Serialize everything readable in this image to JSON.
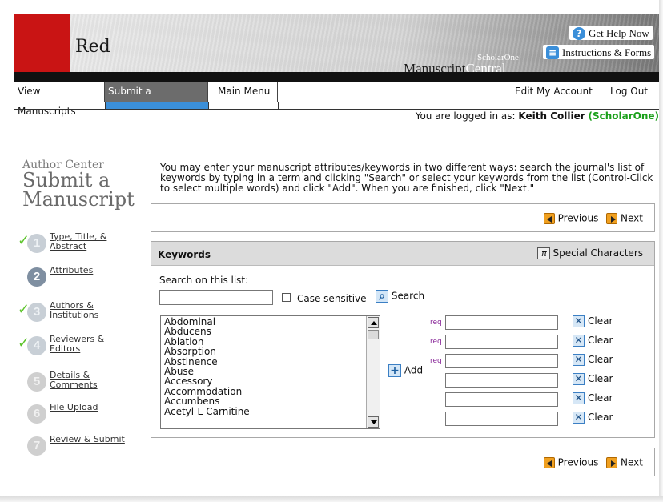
{
  "header": {
    "brand": "Red",
    "product_line1": "ScholarOne",
    "product_line2a": "Manuscript",
    "product_line2b": "Central",
    "help_link": "Get Help Now",
    "instructions_link": "Instructions & Forms",
    "colors": {
      "brand_red": "#c91414",
      "help_blue": "#3b8fd9"
    }
  },
  "nav": {
    "items": [
      {
        "label": "View Manuscripts"
      },
      {
        "label": "Submit a Manuscript",
        "active": true
      },
      {
        "label": "Main Menu"
      },
      {
        "label": "Edit My Account"
      },
      {
        "label": "Log Out"
      }
    ],
    "logged_in_prefix": "You are logged in as:",
    "user": "Keith Collier",
    "org": "(ScholarOne)"
  },
  "sidebar": {
    "section": "Author Center",
    "title_line1": "Submit a",
    "title_line2": "Manuscript",
    "steps": [
      {
        "num": "1",
        "label": "Type, Title, & Abstract",
        "done": true
      },
      {
        "num": "2",
        "label": "Attributes",
        "current": true
      },
      {
        "num": "3",
        "label": "Authors & Institutions",
        "done": true
      },
      {
        "num": "4",
        "label": "Reviewers & Editors",
        "done": true
      },
      {
        "num": "5",
        "label": "Details & Comments"
      },
      {
        "num": "6",
        "label": "File Upload"
      },
      {
        "num": "7",
        "label": "Review & Submit"
      }
    ]
  },
  "main": {
    "intro": "You may enter your manuscript attributes/keywords in two different ways: search the journal's list of keywords by typing in a term and clicking \"Search\" or select your keywords from the list (Control-Click to select multiple words) and click \"Add\". When you are finished, click \"Next.\"",
    "previous_label": "Previous",
    "next_label": "Next",
    "panel_title": "Keywords",
    "special_chars_label": "Special Characters",
    "special_chars_glyph": "π",
    "search_list_label": "Search on this list:",
    "search_value": "",
    "case_sensitive_label": "Case sensitive",
    "search_button_label": "Search",
    "add_button_label": "Add",
    "req_label": "req",
    "clear_label": "Clear",
    "keyword_options": [
      "Abdominal",
      "Abducens",
      "Ablation",
      "Absorption",
      "Abstinence",
      "Abuse",
      "Accessory",
      "Accommodation",
      "Accumbens",
      "Acetyl-L-Carnitine"
    ],
    "keyword_fields": [
      {
        "required": true,
        "value": ""
      },
      {
        "required": true,
        "value": ""
      },
      {
        "required": true,
        "value": ""
      },
      {
        "required": false,
        "value": ""
      },
      {
        "required": false,
        "value": ""
      },
      {
        "required": false,
        "value": ""
      }
    ]
  }
}
